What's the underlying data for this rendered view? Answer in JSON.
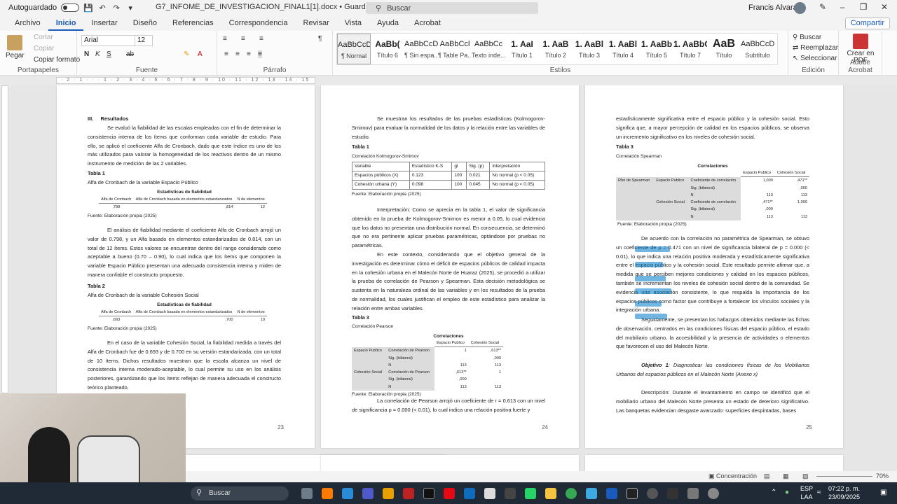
{
  "titlebar": {
    "autosave_label": "Autoguardado",
    "doc_title": "G7_INFOME_DE_INVESTIGACION_FINAL1[1].docx  •  Guardado en Este PC",
    "search_placeholder": "Buscar",
    "user_name": "Francis Alvarado"
  },
  "tabs": [
    "Archivo",
    "Inicio",
    "Insertar",
    "Diseño",
    "Referencias",
    "Correspondencia",
    "Revisar",
    "Vista",
    "Ayuda",
    "Acrobat"
  ],
  "share_label": "Compartir",
  "ribbon": {
    "clipboard": {
      "paste": "Pegar",
      "cut": "Cortar",
      "copy": "Copiar",
      "format_painter": "Copiar formato",
      "label": "Portapapeles"
    },
    "font": {
      "name": "Arial",
      "size": "12",
      "label": "Fuente"
    },
    "paragraph": {
      "label": "Párrafo"
    },
    "styles": {
      "label": "Estilos",
      "items": [
        {
          "sample": "AaBbCcDc",
          "name": "¶ Normal"
        },
        {
          "sample": "AaBb(",
          "name": "Título 6"
        },
        {
          "sample": "AaBbCcDc",
          "name": "¶ Sin espa..."
        },
        {
          "sample": "AaBbCcl",
          "name": "¶ Table Pa..."
        },
        {
          "sample": "AaBbCc",
          "name": "Texto inde..."
        },
        {
          "sample": "1. AaI",
          "name": "Título 1"
        },
        {
          "sample": "1. AaB",
          "name": "Título 2"
        },
        {
          "sample": "1. AaBl",
          "name": "Título 3"
        },
        {
          "sample": "1. AaBl",
          "name": "Título 4"
        },
        {
          "sample": "1. AaBb",
          "name": "Título 5"
        },
        {
          "sample": "1. AaBbC",
          "name": "Título 7"
        },
        {
          "sample": "AaB",
          "name": "Título"
        },
        {
          "sample": "AaBbCcD",
          "name": "Subtítulo"
        }
      ]
    },
    "editing": {
      "find": "Buscar",
      "replace": "Reemplazar",
      "select": "Seleccionar",
      "label": "Edición"
    },
    "adobe": {
      "create_pdf": "Crear en PDF",
      "label": "Adobe Acrobat"
    }
  },
  "page23": {
    "heading_num": "III.",
    "heading": "Resultados",
    "p1": "Se evaluó la fiabilidad de las escalas empleadas con el fin de determinar la consistencia interna de los ítems que conforman cada variable de estudio. Para ello, se aplicó el coeficiente Alfa de Cronbach, dado que este índice es uno de los más utilizados para valorar la homogeneidad de los reactivos dentro de un mismo instrumento de medición de las 2 variables.",
    "t1_label": "Tabla 1",
    "t1_title": "Alfa de Cronbach de la variable Espacio Público",
    "t1_stat": "Estadísticas de fiabilidad",
    "t1_headers": [
      "Alfa de Cronbach",
      "Alfa de Cronbach basada en elementos estandarizados",
      "N de elementos"
    ],
    "t1_values": [
      ",798",
      ",814",
      "12"
    ],
    "source1": "Fuente: Elaboración propia (2025)",
    "p2": "El análisis de fiabilidad mediante el coeficiente Alfa de Cronbach arrojó un valor de 0.798, y un Alfa basado en elementos estandarizados de 0.814, con un total de 12 ítems. Estos valores se encuentran dentro del rango considerado como aceptable a bueno (0.70 – 0.90), lo cual indica que los ítems que componen la variable Espacio Público presentan una adecuada consistencia interna y miden de manera confiable el constructo propuesto.",
    "t2_label": "Tabla 2",
    "t2_title": "Alfa de Cronbach de la variable Cohesión Social",
    "t2_stat": "Estadísticas de fiabilidad",
    "t2_headers": [
      "Alfa de Cronbach",
      "Alfa de Cronbach basada en elementos estandarizados",
      "N de elementos"
    ],
    "t2_values": [
      ",693",
      ",700",
      "10"
    ],
    "source2": "Fuente: Elaboración propia (2025)",
    "p3": "En el caso de la variable Cohesión Social, la fiabilidad medida a través del Alfa de Cronbach fue de 0.693 y de 0.700 en su versión estandarizada, con un total de 10 ítems. Dichos resultados muestran que la escala alcanza un nivel de consistencia interna moderado-aceptable, lo cual permite su uso en los análisis posteriores, garantizando que los ítems reflejan de manera adecuada el constructo teórico planteado.",
    "number": "23"
  },
  "page24": {
    "p1": "Se muestran los resultados de las pruebas estadísticas (Kolmogorov-Smirnov) para evaluar la normalidad de los datos y la relación entre las variables de estudio.",
    "t1_label": "Tabla 1",
    "t1_title": "Correlación Kolmogorov-Smirnov",
    "t1_headers": [
      "Variable",
      "Estadístico K-S",
      "gl",
      "Sig. (p)",
      "Interpretación"
    ],
    "t1_rows": [
      [
        "Espacios públicos (X)",
        "0.123",
        "100",
        "0.021",
        "No normal (p < 0.05)"
      ],
      [
        "Cohesión urbana (Y)",
        "0.098",
        "100",
        "0.045",
        "No normal (p < 0.05)"
      ]
    ],
    "source1": "Fuente: Elaboración propia (2025)",
    "p2": "Interpretación: Como se aprecia en la tabla 1, el valor de significancia obtenido en la prueba de Kolmogorov-Smirnov es menor a 0.05, lo cual evidencia que los datos no presentan una distribución normal. En consecuencia, se determinó que no era pertinente aplicar pruebas paramétricas, optándose por pruebas no paramétricas.",
    "p3": "En este contexto, considerando que el objetivo general de la investigación es determinar cómo el déficit de espacios públicos de calidad impacta en la cohesión urbana en el Malecón Norte de Huaraz (2025), se procedió a utilizar la prueba de correlación de Pearson y Spearman. Esta decisión metodológica se sustenta en la naturaleza ordinal de las variables y en los resultados de la prueba de normalidad, los cuales justifican el empleo de este estadístico para analizar la relación entre ambas variables.",
    "t3_label": "Tabla 3",
    "t3_title": "Correlación Pearson",
    "t3_head": "Correlaciones",
    "t3_cols": [
      "Espacio Publico",
      "Cohesión Social"
    ],
    "t3_rows": [
      [
        "Espacio Publico",
        "Correlación de Pearson",
        "1",
        ",613**"
      ],
      [
        "",
        "Sig. (bilateral)",
        "",
        ",000"
      ],
      [
        "",
        "N",
        "113",
        "113"
      ],
      [
        "Cohesión Social",
        "Correlación de Pearson",
        ",613**",
        "1"
      ],
      [
        "",
        "Sig. (bilateral)",
        ",000",
        ""
      ],
      [
        "",
        "N",
        "113",
        "113"
      ]
    ],
    "source3": "Fuente: Elaboración propia (2025)",
    "p4": "La correlación de Pearson arrojó un coeficiente de r = 0.613 con un nivel de significancia p = 0.000 (< 0.01), lo cual indica una relación positiva fuerte y",
    "number": "24"
  },
  "page25": {
    "p1": "estadísticamente significativa entre el espacio público y la cohesión social. Esto significa que, a mayor percepción de calidad en los espacios públicos, se observa un incremento significativo en los niveles de cohesión social.",
    "t3_label": "Tabla 3",
    "t3_title": "Correlación Spearman",
    "t3_head": "Correlaciones",
    "t3_cols": [
      "Espacio Publico",
      "Cohesión Social"
    ],
    "t3_rows": [
      [
        "Rho de Spearman",
        "Espacio Publico",
        "Coeficiente de correlación",
        "1,000",
        ",471**"
      ],
      [
        "",
        "",
        "Sig. (bilateral)",
        "",
        ",000"
      ],
      [
        "",
        "",
        "N",
        "113",
        "113"
      ],
      [
        "",
        "Cohesión Social",
        "Coeficiente de correlación",
        ",471**",
        "1,000"
      ],
      [
        "",
        "",
        "Sig. (bilateral)",
        ",000",
        ""
      ],
      [
        "",
        "",
        "N",
        "113",
        "113"
      ]
    ],
    "source3": "Fuente: Elaboración propia (2025)",
    "p2": "De acuerdo con la correlación no paramétrica de Spearman, se obtuvo un coeficiente de ρ = 0.471 con un nivel de significancia bilateral de p = 0.000 (< 0.01), lo que indica una relación positiva moderada y estadísticamente significativa entre el espacio público y la cohesión social. Este resultado permite afirmar que, a medida que se perciben mejores condiciones y calidad en los espacios públicos, también se incrementan los niveles de cohesión social dentro de la comunidad. Se evidencia una asociación consistente, lo que respalda la importancia de los espacios públicos como factor que contribuye a fortalecer los vínculos sociales y la integración urbana.",
    "p3": "Seguidamente, se presentan los hallazgos obtenidos mediante las fichas de observación, centrados en las condiciones físicas del espacio público, el estado del mobiliario urbano, la accesibilidad y la presencia de actividades o elementos que favorecen el uso del Malecón Norte.",
    "obj_label": "Objetivo 1",
    "obj_text": ": Diagnosticar las condiciones físicas de los Mobiliarios Urbanos del espacios públicos en el Malecón Norte (Anexo x)",
    "p4": "Descripción: Durante el levantamiento en campo se identificó que el mobiliario urbano del Malecón Norte presenta un estado de deterioro significativo. Las banquetas evidencian desgaste avanzado: superficies despintadas, bases",
    "number": "25"
  },
  "status": {
    "focus": "Concentración",
    "zoom": "70%"
  },
  "taskbar": {
    "search": "Buscar",
    "lang": "ESP",
    "lang2": "LAA",
    "time": "07:22 p. m.",
    "date": "23/09/2025"
  }
}
